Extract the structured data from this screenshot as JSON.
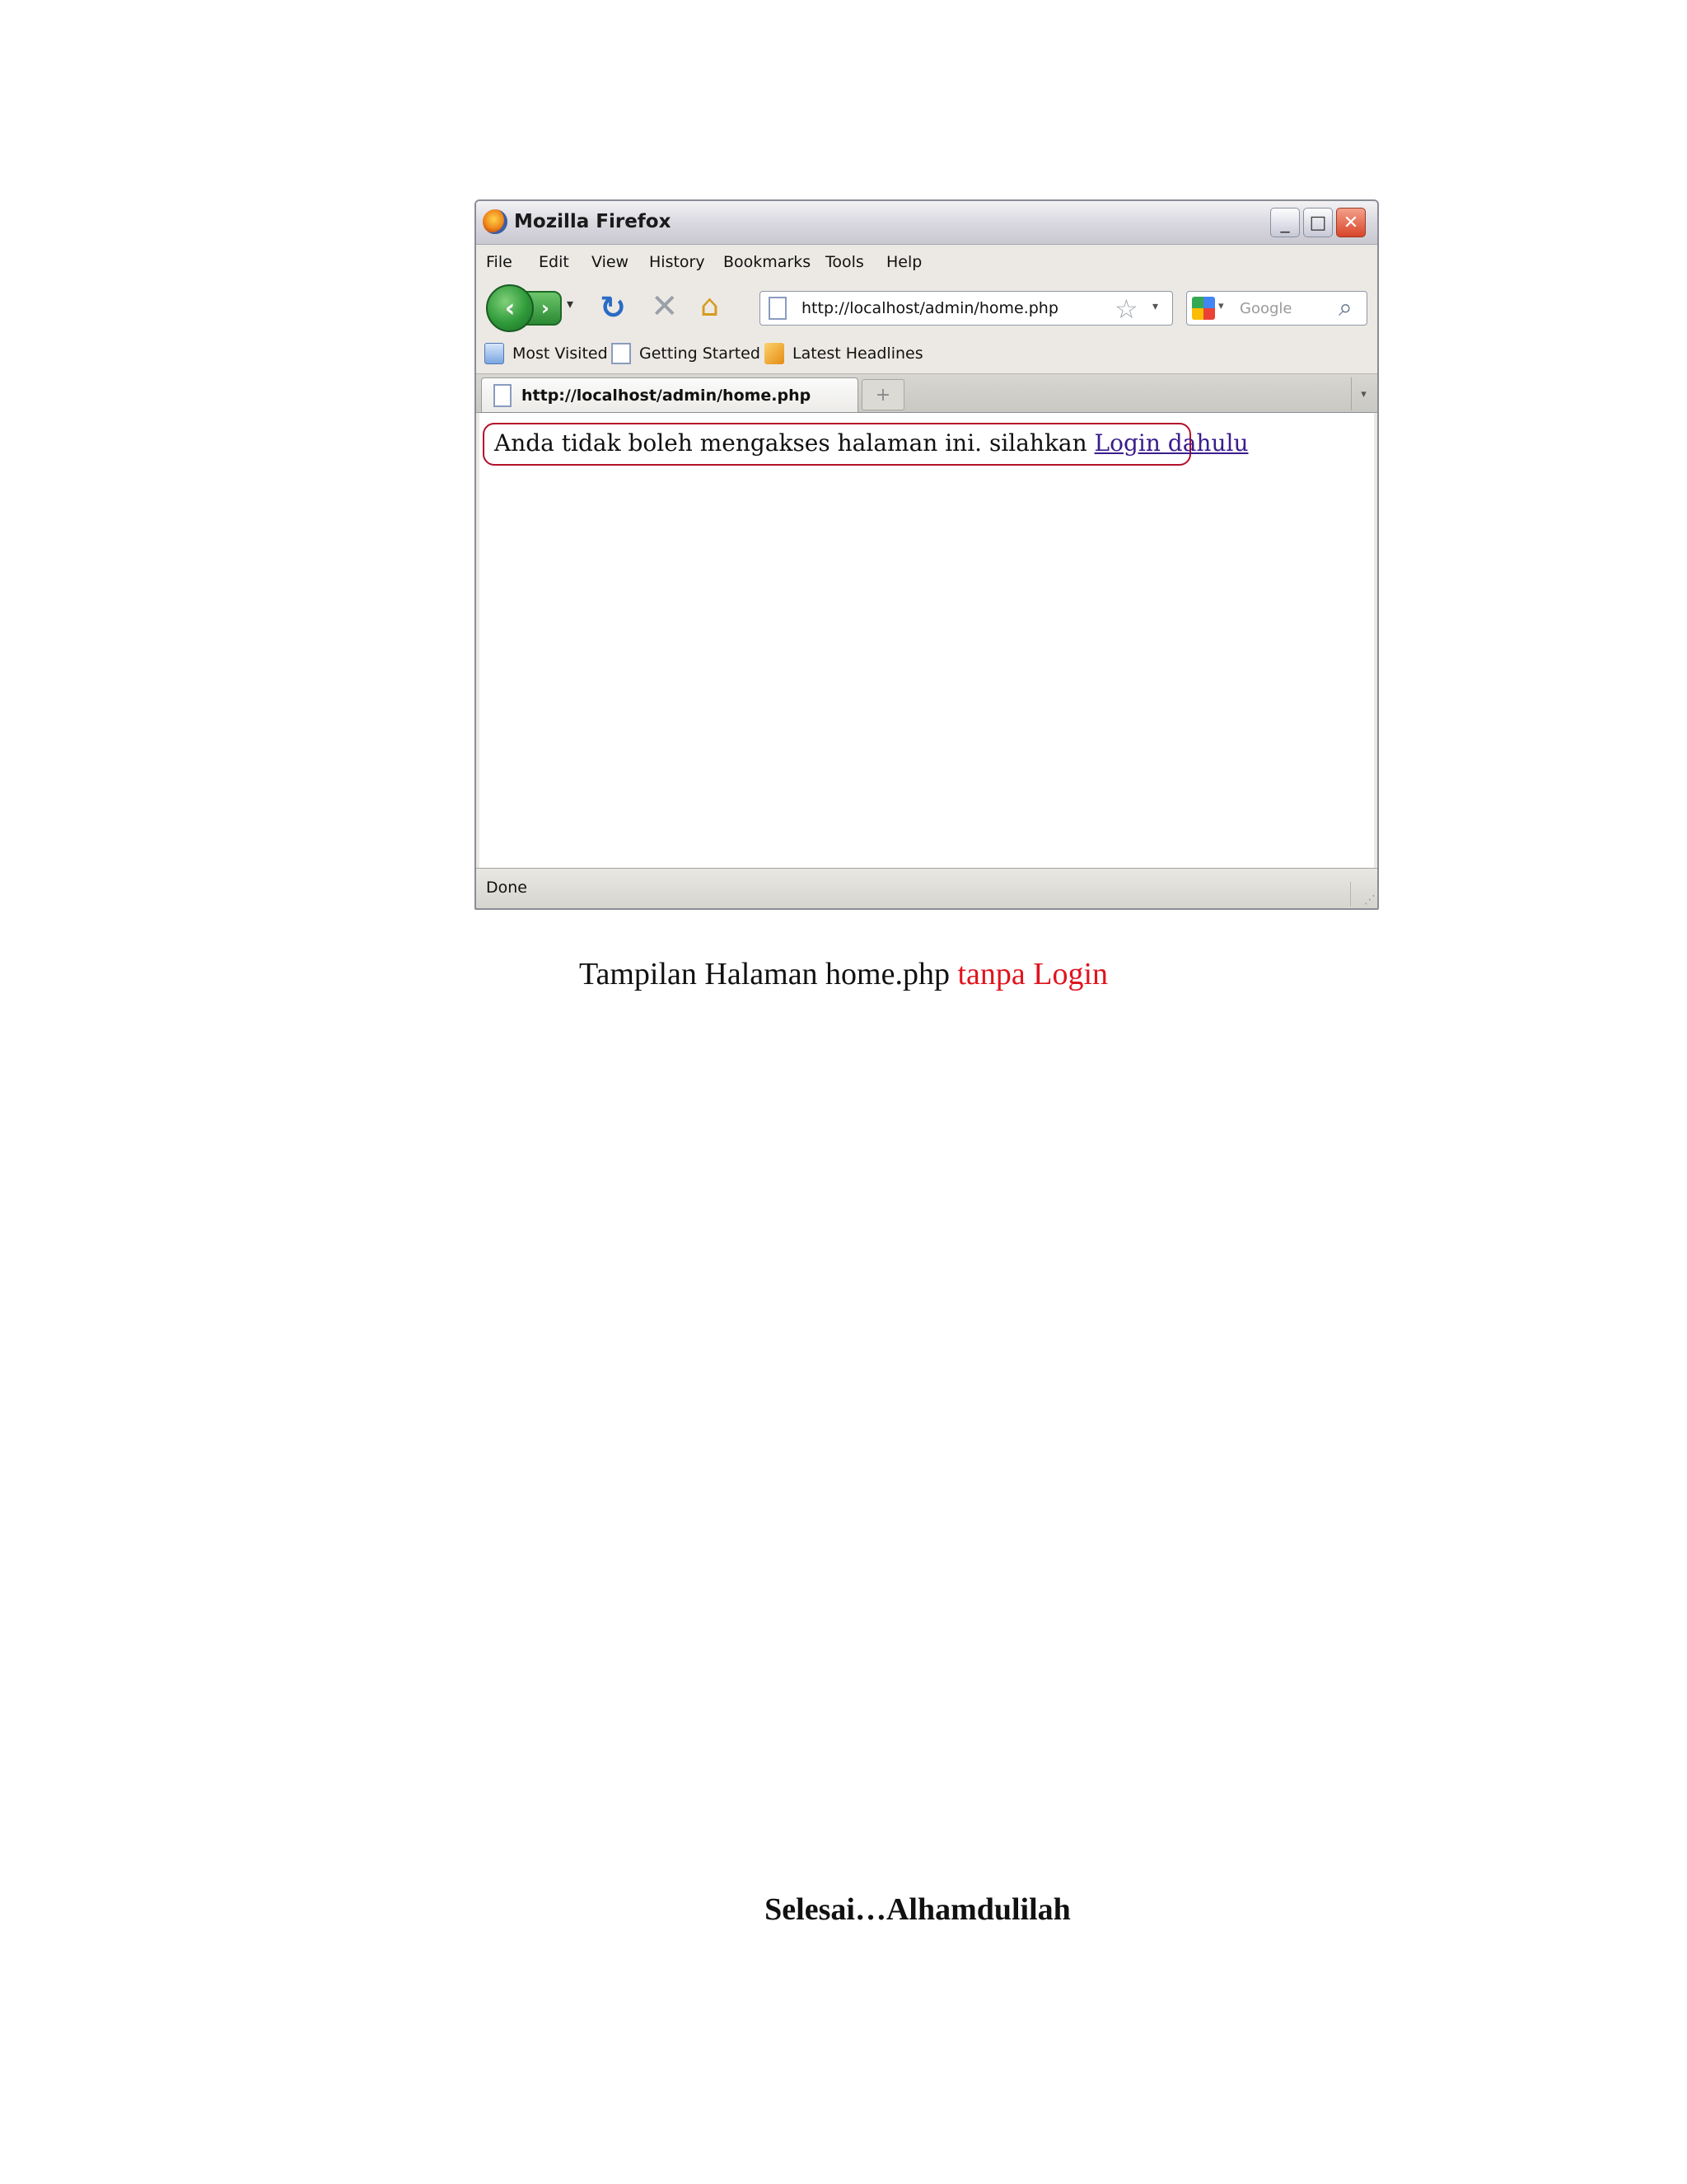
{
  "window": {
    "title": "Mozilla Firefox"
  },
  "menu": [
    "File",
    "Edit",
    "View",
    "History",
    "Bookmarks",
    "Tools",
    "Help"
  ],
  "urlbar": {
    "value": "http://localhost/admin/home.php"
  },
  "search": {
    "placeholder": "Google"
  },
  "bookmarks": [
    "Most Visited",
    "Getting Started",
    "Latest Headlines"
  ],
  "tab": {
    "label": "http://localhost/admin/home.php"
  },
  "content": {
    "notice_text": "Anda tidak boleh mengakses halaman ini. silahkan ",
    "login_link": "Login dahulu"
  },
  "status": {
    "text": "Done"
  },
  "caption": {
    "prefix": "Tampilan Halaman home.php ",
    "highlight": "tanpa Login"
  },
  "closing": {
    "text": "Selesai…Alhamdulilah"
  },
  "colors": {
    "caption_highlight": "#e0141e",
    "notice_border": "#b3102a",
    "link": "#3b1d8c"
  },
  "icons": [
    "firefox-logo-icon",
    "minimize-icon",
    "maximize-icon",
    "close-icon",
    "back-arrow-icon",
    "forward-arrow-icon",
    "reload-icon",
    "stop-icon",
    "home-icon",
    "page-icon",
    "star-icon",
    "google-icon",
    "magnifier-icon",
    "bookmark-folder-icon",
    "rss-icon",
    "new-tab-icon",
    "resize-grip-icon"
  ]
}
